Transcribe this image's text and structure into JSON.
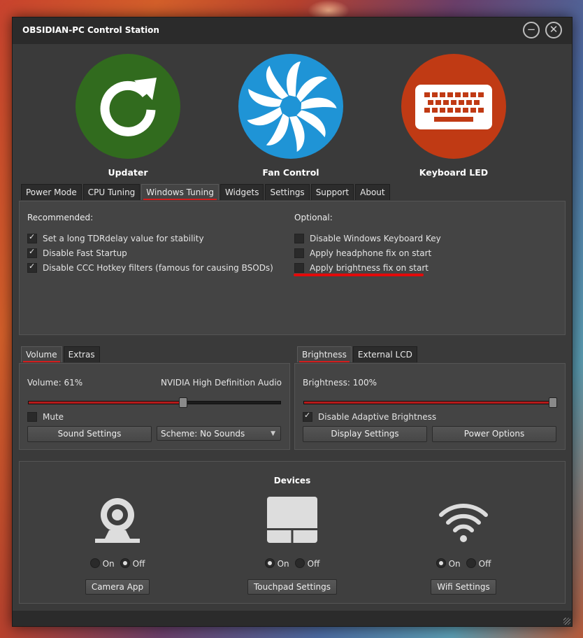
{
  "window": {
    "title": "OBSIDIAN-PC Control Station",
    "minimize_glyph": "−",
    "close_glyph": "✕"
  },
  "tiles": [
    {
      "label": "Updater",
      "icon": "refresh-icon",
      "color": "#316b1e"
    },
    {
      "label": "Fan Control",
      "icon": "fan-icon",
      "color": "#1f94d6"
    },
    {
      "label": "Keyboard LED",
      "icon": "keyboard-icon",
      "color": "#c03a14"
    }
  ],
  "tabs": [
    "Power Mode",
    "CPU Tuning",
    "Windows Tuning",
    "Widgets",
    "Settings",
    "Support",
    "About"
  ],
  "active_tab": "Windows Tuning",
  "tuning": {
    "recommended_title": "Recommended:",
    "recommended": [
      {
        "label": "Set a long TDRdelay value for stability",
        "checked": true
      },
      {
        "label": "Disable Fast Startup",
        "checked": true
      },
      {
        "label": "Disable CCC Hotkey filters (famous for causing BSODs)",
        "checked": true
      }
    ],
    "optional_title": "Optional:",
    "optional": [
      {
        "label": "Disable Windows Keyboard Key",
        "checked": false
      },
      {
        "label": "Apply headphone fix on start",
        "checked": false
      },
      {
        "label": "Apply brightness fix on start",
        "checked": false
      }
    ],
    "highlight_color": "#e30a0a"
  },
  "volume": {
    "tabs": [
      "Volume",
      "Extras"
    ],
    "label": "Volume: 61%",
    "value": 0.61,
    "device": "NVIDIA High Definition Audio",
    "mute_label": "Mute",
    "muted": false,
    "sound_settings": "Sound Settings",
    "scheme": "Scheme: No Sounds"
  },
  "brightness": {
    "tabs": [
      "Brightness",
      "External LCD"
    ],
    "label": "Brightness: 100%",
    "value": 1.0,
    "adaptive_label": "Disable Adaptive Brightness",
    "adaptive_checked": true,
    "display_settings": "Display Settings",
    "power_options": "Power Options"
  },
  "devices": {
    "title": "Devices",
    "on_label": "On",
    "off_label": "Off",
    "items": [
      {
        "icon": "webcam-icon",
        "state": "off",
        "button": "Camera App"
      },
      {
        "icon": "touchpad-icon",
        "state": "on",
        "button": "Touchpad Settings"
      },
      {
        "icon": "wifi-icon",
        "state": "on",
        "button": "Wifi Settings"
      }
    ]
  },
  "accent_color": "#d21d1d"
}
